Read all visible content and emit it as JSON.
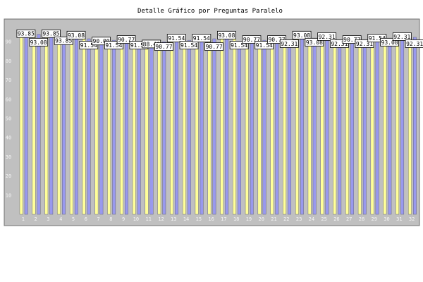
{
  "chart_data": {
    "type": "bar",
    "title": "Detalle Gráfico por Preguntas Paralelo",
    "xlabel": "",
    "ylabel": "",
    "ylim": [
      0,
      100
    ],
    "yticks": [
      10,
      20,
      30,
      40,
      50,
      60,
      70,
      80,
      90
    ],
    "grid": false,
    "legend": "none",
    "categories": [
      "1",
      "2",
      "3",
      "4",
      "5",
      "6",
      "7",
      "8",
      "9",
      "10",
      "11",
      "12",
      "13",
      "14",
      "15",
      "16",
      "17",
      "18",
      "19",
      "20",
      "21",
      "22",
      "23",
      "24",
      "25",
      "26",
      "27",
      "28",
      "29",
      "30",
      "31",
      "32"
    ],
    "series": [
      {
        "color": "#ffff99",
        "values": [
          93.85,
          93.08,
          93.85,
          93.85,
          93.08,
          91.54,
          90.0,
          91.54,
          90.77,
          91.54,
          88.46,
          90.77,
          91.54,
          91.54,
          91.54,
          90.77,
          93.08,
          91.54,
          90.77,
          91.54,
          90.77,
          92.31,
          93.08,
          93.08,
          92.31,
          92.31,
          90.77,
          92.31,
          91.54,
          93.08,
          92.31,
          92.31
        ]
      },
      {
        "color": "#9999ee",
        "values": [
          93.08,
          93.85,
          93.85,
          92.31,
          92.31,
          91.54,
          91.54,
          90.77,
          90.77,
          90.0,
          90.77,
          90.0,
          90.77,
          90.77,
          90.77,
          91.54,
          91.54,
          89.23,
          89.23,
          90.77,
          90.77,
          90.77,
          91.54,
          91.54,
          91.54,
          90.0,
          90.77,
          90.77,
          90.77,
          91.54,
          93.08,
          92.31
        ]
      }
    ],
    "data_labels": [
      {
        "cat": 0,
        "value": "93.85"
      },
      {
        "cat": 1,
        "value": "93.08"
      },
      {
        "cat": 2,
        "value": "93.85"
      },
      {
        "cat": 3,
        "value": "93.85"
      },
      {
        "cat": 4,
        "value": "93.08"
      },
      {
        "cat": 5,
        "value": "91.54"
      },
      {
        "cat": 6,
        "value": "90.00"
      },
      {
        "cat": 7,
        "value": "91.54"
      },
      {
        "cat": 8,
        "value": "90.77"
      },
      {
        "cat": 9,
        "value": "91.54"
      },
      {
        "cat": 10,
        "value": "88.46"
      },
      {
        "cat": 11,
        "value": "90.77"
      },
      {
        "cat": 12,
        "value": "91.54"
      },
      {
        "cat": 13,
        "value": "91.54"
      },
      {
        "cat": 14,
        "value": "91.54"
      },
      {
        "cat": 15,
        "value": "90.77"
      },
      {
        "cat": 16,
        "value": "93.08"
      },
      {
        "cat": 17,
        "value": "91.54"
      },
      {
        "cat": 18,
        "value": "90.77"
      },
      {
        "cat": 19,
        "value": "91.54"
      },
      {
        "cat": 20,
        "value": "90.77"
      },
      {
        "cat": 21,
        "value": "92.31"
      },
      {
        "cat": 22,
        "value": "93.08"
      },
      {
        "cat": 23,
        "value": "93.08"
      },
      {
        "cat": 24,
        "value": "92.31"
      },
      {
        "cat": 25,
        "value": "92.31"
      },
      {
        "cat": 26,
        "value": "90.77"
      },
      {
        "cat": 27,
        "value": "92.31"
      },
      {
        "cat": 28,
        "value": "91.54"
      },
      {
        "cat": 29,
        "value": "93.08"
      },
      {
        "cat": 30,
        "value": "92.31"
      },
      {
        "cat": 31,
        "value": "92.31"
      }
    ],
    "colors": {
      "frame_bg": "#c0c0c0",
      "frame_border": "#707070",
      "label_bg": "#ffffff",
      "label_border": "#000000",
      "tick_text": "#f4f4f4"
    }
  }
}
